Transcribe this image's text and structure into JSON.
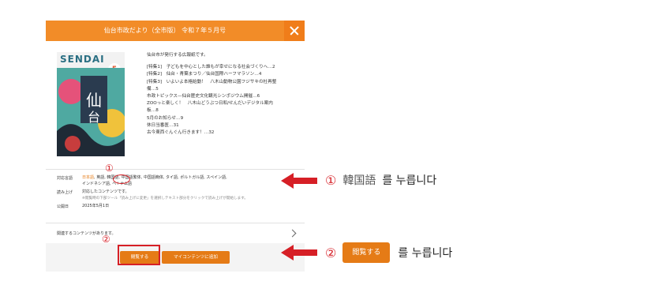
{
  "modal": {
    "title": "仙台市政だより（全市版） 令和７年５月号",
    "cover": {
      "logo": "SENDAI",
      "issue": "5"
    },
    "description": {
      "lead": "仙台市が発行する広報紙です。",
      "lines": [
        "[特集1]　子どもを中心とした誰もが幸せになる社会づくりへ…2",
        "[特集2]　仙台・青葉まつり／仙台国際ハーフマラソン…4",
        "[特集3]　いよいよ本格始動！　八木山動物公園フジサキの杜再整",
        "備…5",
        "市政トピックス—仙台歴史文化観光シンポジウム開催…6",
        "ZOOっと楽しく！　八木山どうぶつ日和/せんだいデジタル案内",
        "板…8",
        "5月のお知らせ…9",
        "休日当番医…31",
        "古今東西ぐんぐん行きます！…32"
      ]
    },
    "meta": {
      "languages_label": "対応言語",
      "languages_line1": [
        "日本語",
        "英語",
        "韓国語",
        "中国語繁体",
        "中国語簡体",
        "タイ語",
        "ポルトガル語",
        "スペイン語"
      ],
      "languages_line2": [
        "インドネシア語",
        "ベトナム語"
      ],
      "readaloud_label": "読み上げ",
      "readaloud_value": "対応したコンテンツです。",
      "readaloud_note": "※閲覧時の下部ツール「読み上げに変更」を選択しテキスト部分をクリックで読み上げが開始します。",
      "published_label": "公開日",
      "published_value": "2025年5月1日"
    },
    "related": "関連するコンテンツがあります。",
    "buttons": {
      "view": "閲覧する",
      "add": "マイコンテンツに追加"
    }
  },
  "annotations": {
    "marker1": "①",
    "marker2": "②",
    "step1": {
      "num": "①",
      "key": "韓国語",
      "text": "를 누릅니다"
    },
    "step2": {
      "num": "②",
      "button": "閲覧する",
      "text": "를 누릅니다"
    }
  },
  "colors": {
    "accent": "#f28c28",
    "button": "#e57b16",
    "annotation": "#d61f26"
  }
}
